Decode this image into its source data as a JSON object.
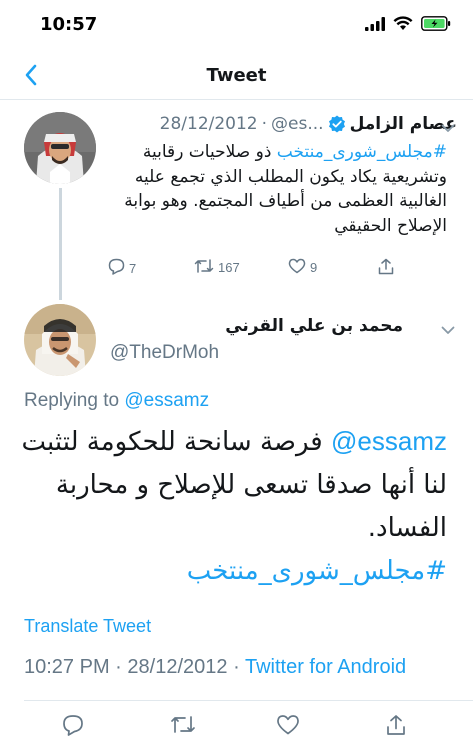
{
  "status_bar": {
    "time": "10:57"
  },
  "nav": {
    "title": "Tweet"
  },
  "parent_tweet": {
    "author_name": "عصام الزامل",
    "handle": "@es...",
    "separator": "·",
    "date": "28/12/2012",
    "hashtag": "#مجلس_شورى_منتخب",
    "text": "ذو صلاحيات رقابية وتشريعية يكاد يكون المطلب الذي تجمع عليه الغالبية العظمى من أطياف المجتمع. وهو بوابة الإصلاح الحقيقي",
    "replies": "7",
    "retweets": "167",
    "likes": "9"
  },
  "reply_tweet": {
    "author_name": "محمد بن علي القرني",
    "handle": "@TheDrMoh",
    "replying_prefix": "Replying to",
    "replying_to": "@essamz",
    "mention": "@essamz",
    "text": "فرصة سانحة للحكومة لتثبت لنا أنها صدقا تسعى للإصلاح و محاربة الفساد.",
    "hashtag": "#مجلس_شورى_منتخب",
    "translate_label": "Translate Tweet",
    "time": "10:27 PM",
    "separator": "·",
    "date": "28/12/2012",
    "source": "Twitter for Android"
  },
  "colors": {
    "accent": "#1da1f2",
    "secondary_text": "#657786",
    "battery": "#4cd964"
  },
  "icons": [
    "signal-icon",
    "wifi-icon",
    "battery-icon",
    "back-chevron-icon",
    "verified-icon",
    "caret-down-icon",
    "reply-icon",
    "retweet-icon",
    "like-icon",
    "share-icon"
  ]
}
